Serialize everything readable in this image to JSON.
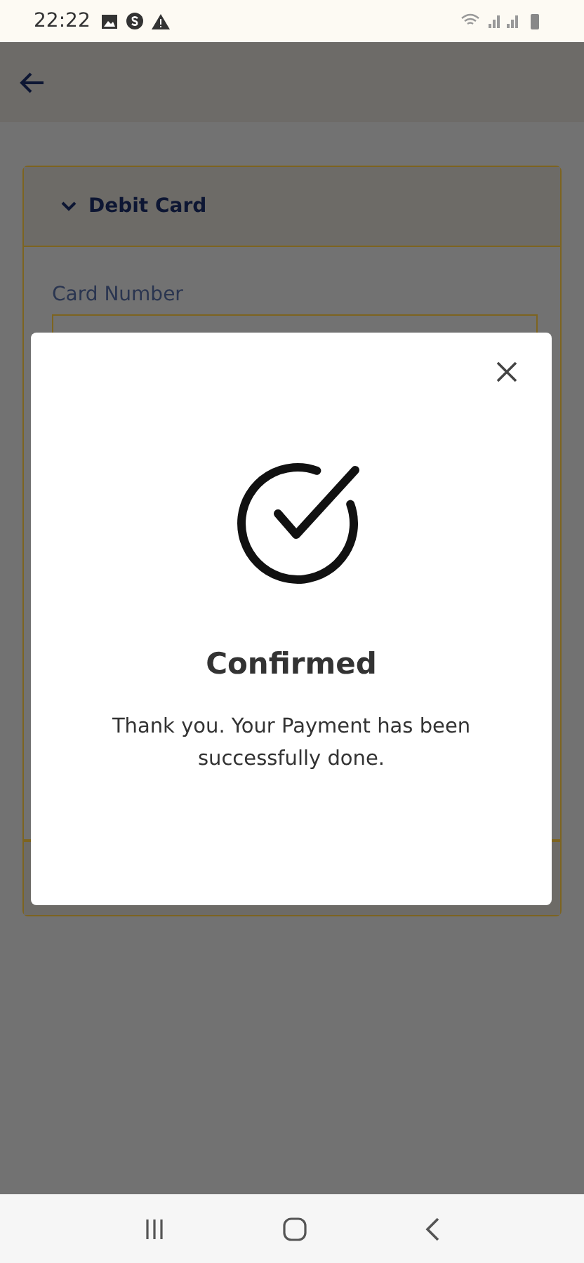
{
  "status_bar": {
    "time": "22:22"
  },
  "payment_card": {
    "title": "Debit Card",
    "expanded": true,
    "field_label": "Card Number"
  },
  "dialog": {
    "title": "Confirmed",
    "message": "Thank you. Your Payment has been successfully done."
  }
}
